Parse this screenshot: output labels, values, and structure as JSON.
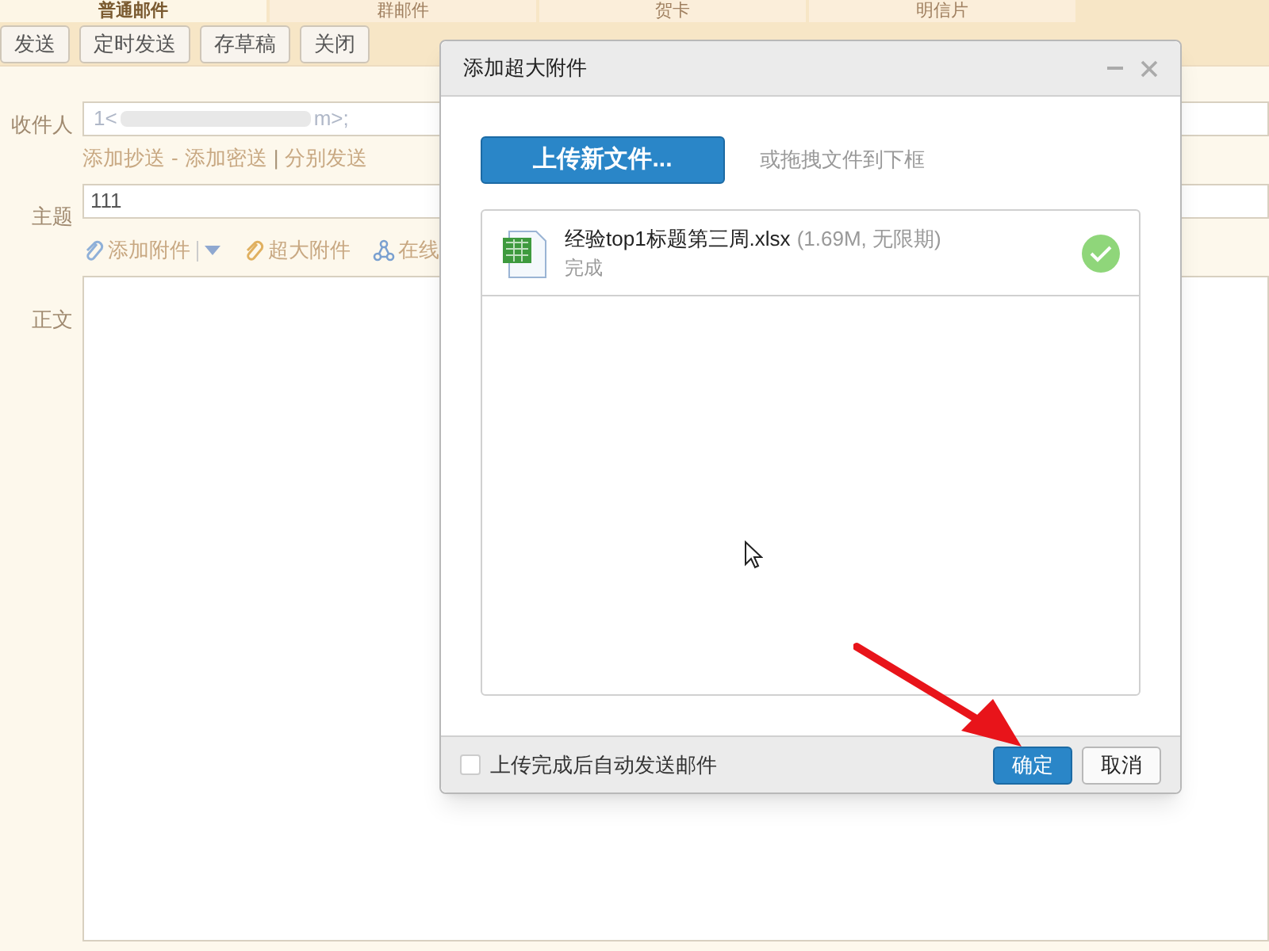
{
  "tabs": [
    {
      "label": "普通邮件",
      "selected": true
    },
    {
      "label": "群邮件",
      "selected": false
    },
    {
      "label": "贺卡",
      "selected": false
    },
    {
      "label": "明信片",
      "selected": false
    }
  ],
  "toolbar": [
    "发送",
    "定时发送",
    "存草稿",
    "关闭"
  ],
  "compose": {
    "to_label": "收件人",
    "to_value_start": "1<",
    "to_value_end": "m>;",
    "cc_links": [
      "添加抄送",
      "添加密送"
    ],
    "separator_1": "-",
    "separator_2": "|",
    "separate_send": "分别发送",
    "subject_label": "主题",
    "subject_value": "111",
    "attach": "添加附件",
    "large_attach": "超大附件",
    "online": "在线",
    "body_label": "正文"
  },
  "dialog": {
    "title": "添加超大附件",
    "upload_button": "上传新文件...",
    "drag_hint": "或拖拽文件到下框",
    "files": [
      {
        "name": "经验top1标题第三周.xlsx",
        "meta": "(1.69M, 无限期)",
        "status": "完成",
        "done": true
      }
    ],
    "auto_send": {
      "label": "上传完成后自动发送邮件",
      "checked": false
    },
    "buttons": [
      {
        "label": "确定",
        "kind": "primary"
      },
      {
        "label": "取消",
        "kind": "secondary"
      }
    ]
  }
}
